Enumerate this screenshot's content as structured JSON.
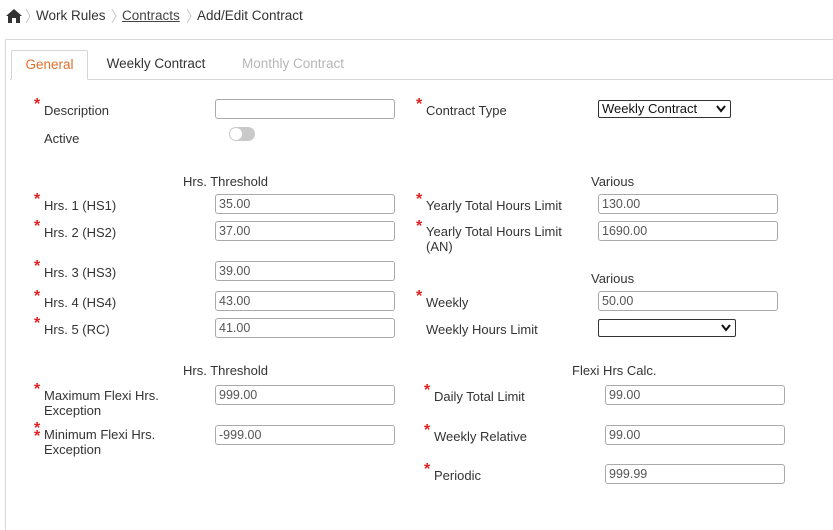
{
  "breadcrumb": {
    "home_icon": "home-icon",
    "items": [
      "Work Rules",
      "Contracts",
      "Add/Edit Contract"
    ]
  },
  "tabs": [
    {
      "label": "General",
      "state": "active"
    },
    {
      "label": "Weekly Contract",
      "state": "normal"
    },
    {
      "label": "Monthly Contract",
      "state": "disabled"
    }
  ],
  "general": {
    "description": {
      "label": "Description",
      "value": ""
    },
    "active": {
      "label": "Active",
      "checked": false
    },
    "contract_type": {
      "label": "Contract Type",
      "value": "Weekly Contract"
    }
  },
  "hrs_threshold": {
    "header": "Hrs. Threshold",
    "fields": [
      {
        "label": "Hrs. 1 (HS1)",
        "value": "35.00"
      },
      {
        "label": "Hrs. 2 (HS2)",
        "value": "37.00"
      },
      {
        "label": "Hrs. 3 (HS3)",
        "value": "39.00"
      },
      {
        "label": "Hrs. 4 (HS4)",
        "value": "43.00"
      },
      {
        "label": "Hrs. 5 (RC)",
        "value": "41.00"
      }
    ]
  },
  "various_1": {
    "header": "Various",
    "yearly_total": {
      "label": "Yearly Total Hours Limit",
      "value": "130.00"
    },
    "yearly_total_an": {
      "label_line1": "Yearly Total Hours Limit",
      "label_line2": "(AN)",
      "value": "1690.00"
    }
  },
  "various_2": {
    "header": "Various",
    "weekly": {
      "label": "Weekly",
      "value": "50.00"
    },
    "weekly_hours_limit": {
      "label": "Weekly Hours Limit",
      "value": ""
    }
  },
  "flexi_threshold": {
    "header": "Hrs. Threshold",
    "max": {
      "label_line1": "Maximum Flexi Hrs.",
      "label_line2": "Exception",
      "value": "999.00"
    },
    "min": {
      "label_line1": "Minimum Flexi Hrs.",
      "label_line2": "Exception",
      "value": "-999.00"
    }
  },
  "flexi_calc": {
    "header": "Flexi Hrs Calc.",
    "daily": {
      "label": "Daily Total Limit",
      "value": "99.00"
    },
    "weekly_relative": {
      "label": "Weekly Relative",
      "value": "99.00"
    },
    "periodic": {
      "label": "Periodic",
      "value": "999.99"
    }
  },
  "colors": {
    "accent": "#e0702d",
    "required": "#e02020",
    "disabled_text": "#b6b6b6"
  }
}
